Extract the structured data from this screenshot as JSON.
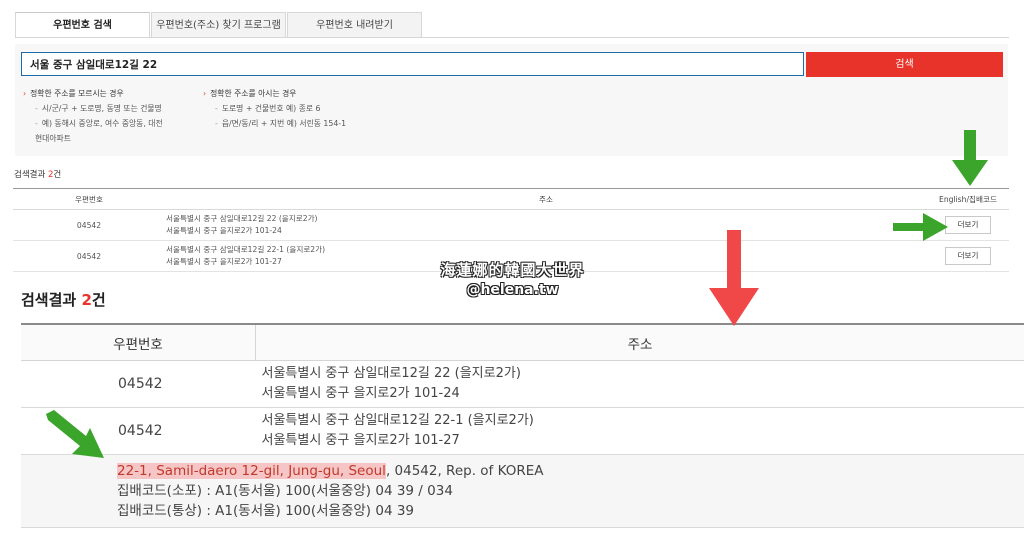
{
  "tabs": [
    {
      "label": "우편번호 검색"
    },
    {
      "label": "우편번호(주소) 찾기 프로그램"
    },
    {
      "label": "우편번호 내려받기"
    }
  ],
  "search": {
    "value": "서울 중구 삼일대로12길 22",
    "button_label": "검색"
  },
  "hints": {
    "left": {
      "title": "정확한 주소를 모르시는 경우",
      "items": [
        "시/군/구 + 도로명, 동명 또는 건물명",
        "예) 동해시 중앙로, 여수 중앙동, 대전",
        "현대아파트"
      ]
    },
    "right": {
      "title": "정확한 주소를 아시는 경우",
      "items": [
        "도로명 + 건물번호 예) 종로 6",
        "읍/면/동/리 + 지번 예) 서린동 154-1"
      ]
    },
    "mark": "›",
    "dash": "-"
  },
  "results": {
    "count_prefix": "검색결과",
    "count": "2",
    "count_suffix": "건",
    "headers": {
      "zip": "우편번호",
      "address": "주소",
      "english": "English/집배코드"
    },
    "more_label": "더보기",
    "rows": [
      {
        "zip": "04542",
        "road": "서울특별시 중구 삼일대로12길 22 (을지로2가)",
        "jibun": "서울특별시 중구 을지로2가 101-24"
      },
      {
        "zip": "04542",
        "road": "서울특별시 중구 삼일대로12길 22-1 (을지로2가)",
        "jibun": "서울특별시 중구 을지로2가 101-27"
      }
    ],
    "detail": {
      "english_highlight": "22-1, Samil-daero 12-gil, Jung-gu, Seoul",
      "english_rest": ", 04542, Rep. of KOREA",
      "code_sopo": "집배코드(소포) : A1(동서울) 100(서울중앙) 04 39 / 034",
      "code_tongsang": "집배코드(통상) : A1(동서울) 100(서울중앙) 04 39"
    }
  },
  "watermark": {
    "line1": "海蓮娜的韓國大世界",
    "line2": "@helena.tw"
  },
  "colors": {
    "accent_red": "#e8332a",
    "arrow_green": "#3aa52a",
    "arrow_red": "#f04848",
    "highlight": "#f6c6c6"
  }
}
